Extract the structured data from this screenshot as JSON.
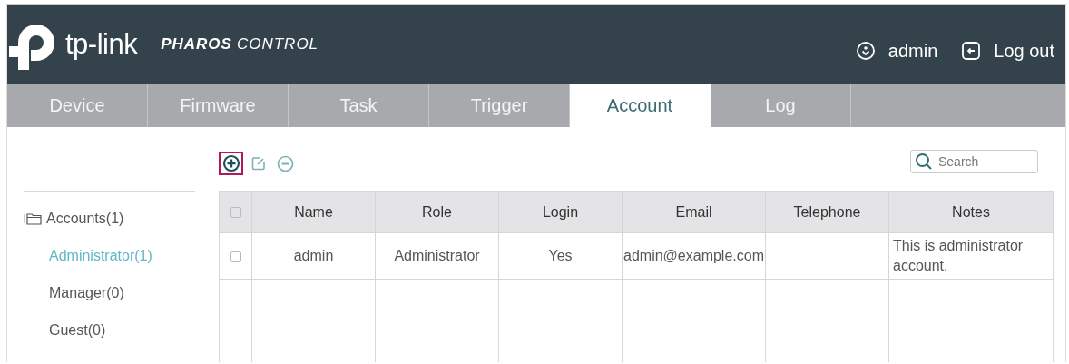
{
  "header": {
    "logo_text": "tp-link",
    "product_bold": "PHAROS",
    "product_light": "CONTROL",
    "user": "admin",
    "logout": "Log out"
  },
  "tabs": [
    {
      "label": "Device",
      "selected": false
    },
    {
      "label": "Firmware",
      "selected": false
    },
    {
      "label": "Task",
      "selected": false
    },
    {
      "label": "Trigger",
      "selected": false
    },
    {
      "label": "Account",
      "selected": true
    },
    {
      "label": "Log",
      "selected": false
    }
  ],
  "toolbar": {
    "buttons": [
      {
        "kind": "add",
        "selected": true
      },
      {
        "kind": "edit",
        "selected": false
      },
      {
        "kind": "remove",
        "selected": false
      }
    ],
    "search": {
      "placeholder": "Search"
    }
  },
  "sidebar": {
    "tree": [
      {
        "label": "Accounts(1)",
        "selected": false,
        "children": [
          {
            "label": "Administrator(1)",
            "selected": true
          },
          {
            "label": "Manager(0)",
            "selected": false
          },
          {
            "label": "Guest(0)",
            "selected": false
          }
        ]
      }
    ]
  },
  "table": {
    "columns": [
      "Name",
      "Role",
      "Login",
      "Email",
      "Telephone",
      "Notes"
    ],
    "header_checked": false,
    "rows": [
      {
        "checked": false,
        "cells": [
          "admin",
          "Administrator",
          "Yes",
          "admin@example.com",
          "",
          "This is administrator account."
        ]
      }
    ]
  }
}
